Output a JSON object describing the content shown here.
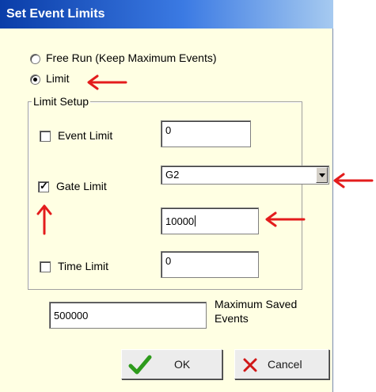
{
  "dialog": {
    "title": "Set Event Limits",
    "mode_options": [
      {
        "label": "Free Run (Keep Maximum Events)",
        "selected": false
      },
      {
        "label": "Limit",
        "selected": true
      }
    ],
    "limit_setup": {
      "group_label": "Limit Setup",
      "event_limit": {
        "label": "Event Limit",
        "checked": false,
        "value": "0"
      },
      "gate_limit": {
        "label": "Gate Limit",
        "checked": true,
        "gate_value": "G2",
        "value": "10000"
      },
      "time_limit": {
        "label": "Time Limit",
        "checked": false,
        "value": "0"
      }
    },
    "max_saved": {
      "value": "500000",
      "label_line1": "Maximum Saved",
      "label_line2": "Events"
    },
    "buttons": {
      "ok": "OK",
      "cancel": "Cancel"
    }
  },
  "colors": {
    "annotation_arrow": "#e31c1c",
    "ok_icon": "#2e9b1c",
    "cancel_icon": "#d01818",
    "titlebar": "#0a3da8"
  },
  "icons": {
    "ok": "checkmark-icon",
    "cancel": "x-icon",
    "annotations": "red-arrow-icon"
  }
}
